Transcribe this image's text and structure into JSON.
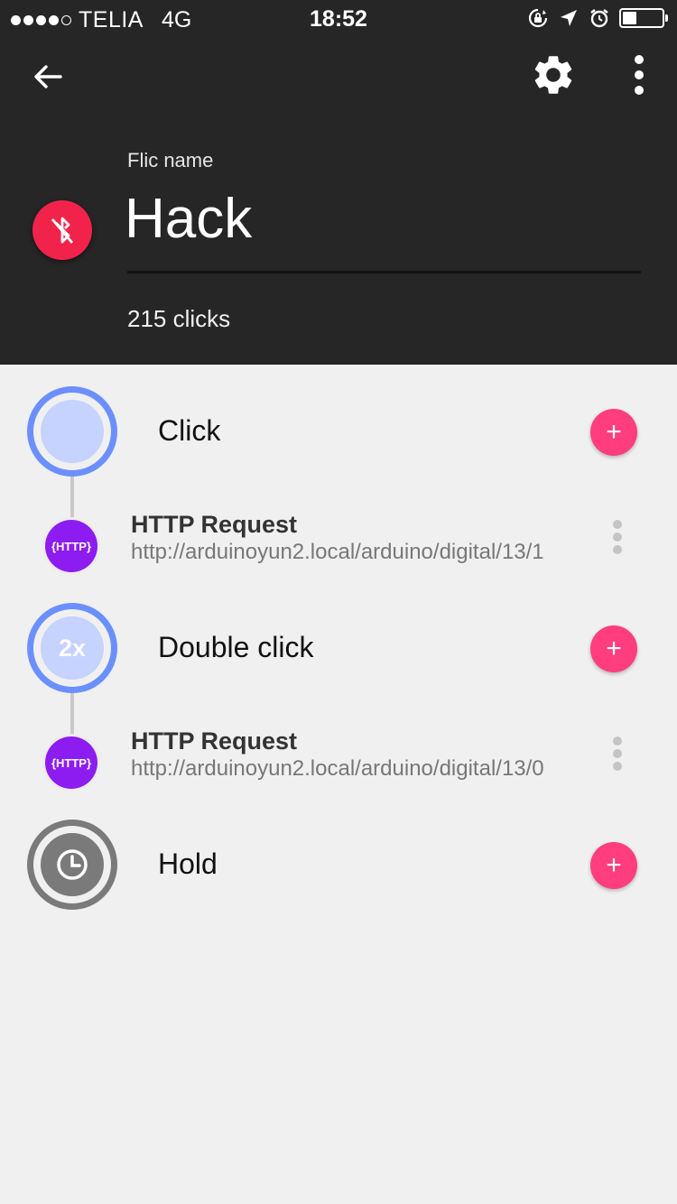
{
  "status_bar": {
    "carrier": "TELIA",
    "network": "4G",
    "time": "18:52",
    "signal_bars_filled": 4,
    "signal_bars_total": 5,
    "battery_level": 0.35
  },
  "header": {
    "name_label": "Flic name",
    "name_value": "Hack",
    "click_count": "215 clicks",
    "badge_color": "#f2234b",
    "background": "#262626"
  },
  "events": [
    {
      "label": "Click",
      "icon": "click-ring",
      "core_text": "",
      "actions": [
        {
          "title": "HTTP Request",
          "badge": "{HTTP}",
          "url": "http://arduinoyun2.local/arduino/digital/13/1"
        }
      ]
    },
    {
      "label": "Double click",
      "icon": "double-click-ring",
      "core_text": "2x",
      "actions": [
        {
          "title": "HTTP Request",
          "badge": "{HTTP}",
          "url": "http://arduinoyun2.local/arduino/digital/13/0"
        }
      ]
    },
    {
      "label": "Hold",
      "icon": "clock-icon",
      "core_text": "",
      "actions": []
    }
  ],
  "add_button_label": "+",
  "colors": {
    "accent_pink": "#ff3d7f",
    "ring_blue": "#6b8ffe",
    "ring_blue_core": "#c6d2ff",
    "ring_gray": "#7a7a7a",
    "http_purple": "#8c1cf0"
  }
}
